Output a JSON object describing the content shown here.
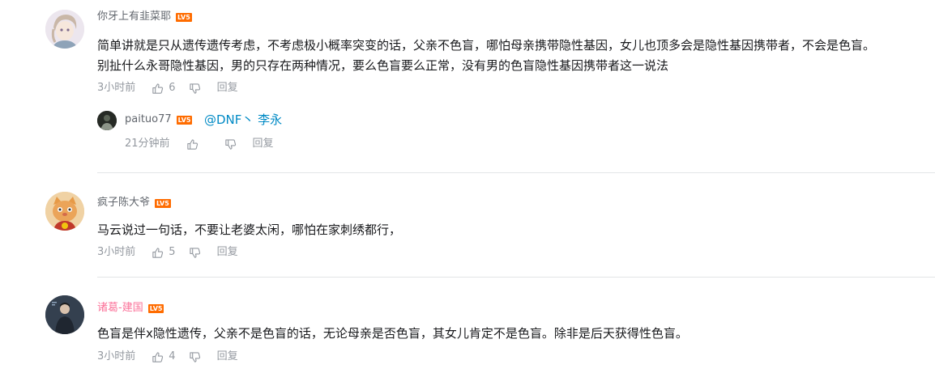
{
  "level_badge": "LV5",
  "reply_label": "回复",
  "comments": [
    {
      "username": "你牙上有韭菜耶",
      "text_line1": "简单讲就是只从遗传遗传考虑，不考虑极小概率突变的话，父亲不色盲，哪怕母亲携带隐性基因，女儿也顶多会是隐性基因携带者，不会是色盲。",
      "text_line2": "别扯什么永哥隐性基因，男的只存在两种情况，要么色盲要么正常，没有男的色盲隐性基因携带者这一说法",
      "time": "3小时前",
      "likes": "6",
      "reply": {
        "username": "paituo77",
        "text": "@DNF丶 李永",
        "time": "21分钟前"
      }
    },
    {
      "username": "疯子陈大爷",
      "text_line1": "马云说过一句话，不要让老婆太闲，哪怕在家刺绣都行，",
      "time": "3小时前",
      "likes": "5"
    },
    {
      "username": "诸葛-建国",
      "text_line1": "色盲是伴x隐性遗传，父亲不是色盲的话，无论母亲是否色盲，其女儿肯定不是色盲。除非是后天获得性色盲。",
      "time": "3小时前",
      "likes": "4"
    }
  ],
  "colors": {
    "username_default": "#61666d",
    "username_vip": "#fb7299",
    "level_badge": "#ff6c00",
    "at_link": "#008ac5",
    "meta": "#9499a0"
  },
  "icons": {
    "like": "thumb-up-icon",
    "dislike": "thumb-down-icon"
  }
}
